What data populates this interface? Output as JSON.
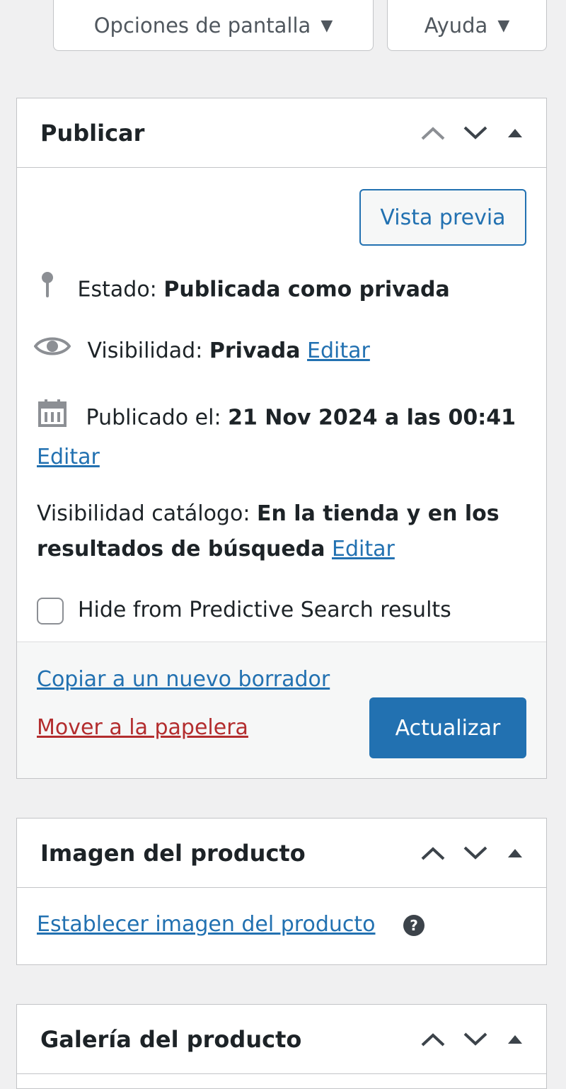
{
  "screen_options": {
    "label": "Opciones de pantalla",
    "arrow": "▼"
  },
  "help_tab": {
    "label": "Ayuda",
    "arrow": "▼"
  },
  "publish": {
    "title": "Publicar",
    "preview_label": "Vista previa",
    "status_label": "Estado:",
    "status_value": "Publicada como privada",
    "visibility_label": "Visibilidad:",
    "visibility_value": "Privada",
    "visibility_edit": "Editar",
    "published_label": "Publicado el:",
    "published_value": "21 Nov 2024 a las 00:41",
    "published_edit": "Editar",
    "catalog_label": "Visibilidad catálogo:",
    "catalog_value": "En la tienda y en los resultados de búsqueda",
    "catalog_edit": "Editar",
    "hide_predictive_label": "Hide from Predictive Search results",
    "hide_predictive_checked": false,
    "copy_draft": "Copiar a un nuevo borrador",
    "trash": "Mover a la papelera",
    "update": "Actualizar"
  },
  "product_image": {
    "title": "Imagen del producto",
    "set_link": "Establecer imagen del producto",
    "help_glyph": "?"
  },
  "gallery": {
    "title": "Galería del producto"
  },
  "icons": {
    "move_up": "chevron-up-icon",
    "move_down": "chevron-down-icon",
    "toggle": "triangle-up-icon",
    "status": "pin-icon",
    "visibility": "eye-icon",
    "published": "calendar-icon",
    "help": "help-icon"
  },
  "colors": {
    "link": "#2271b1",
    "primary_button": "#2271b1",
    "trash_link": "#b32d2e",
    "background": "#f0f0f1",
    "border": "#c3c4c7"
  }
}
